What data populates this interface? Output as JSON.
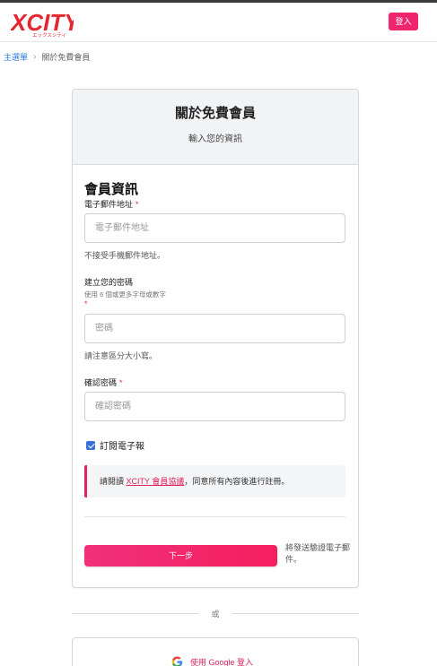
{
  "header": {
    "logo_text": "XCITY",
    "logo_sub": "エックスシティ",
    "login_label": "登入"
  },
  "breadcrumb": {
    "home": "主選單",
    "separator": "›",
    "current": "關於免費會員"
  },
  "card": {
    "title": "關於免費會員",
    "subtitle": "輸入您的資訊"
  },
  "form": {
    "section_title": "會員資訊",
    "email": {
      "label": "電子郵件地址",
      "required": "*",
      "placeholder": "電子郵件地址",
      "note": "不接受手機郵件地址。"
    },
    "password": {
      "label": "建立您的密碼",
      "hint": "使用 6 個或更多字母或數字",
      "required": "*",
      "placeholder": "密碼",
      "note": "請注意區分大小寫。"
    },
    "confirm": {
      "label": "確認密碼",
      "required": "*",
      "placeholder": "確認密碼"
    },
    "newsletter": {
      "label": "訂閱電子報",
      "checked": true
    },
    "notice": {
      "prefix": "請閱讀 ",
      "link": "XCITY 會員協議",
      "suffix": "，同意所有內容後進行註冊。"
    },
    "next_label": "下一步",
    "next_note": "將發送驗證電子郵件。"
  },
  "or_label": "或",
  "google": {
    "label": "使用 Google 登入"
  },
  "colors": {
    "brand": "#f0266c",
    "link_blue": "#2a7ae2",
    "accent_red": "#e0245e"
  }
}
